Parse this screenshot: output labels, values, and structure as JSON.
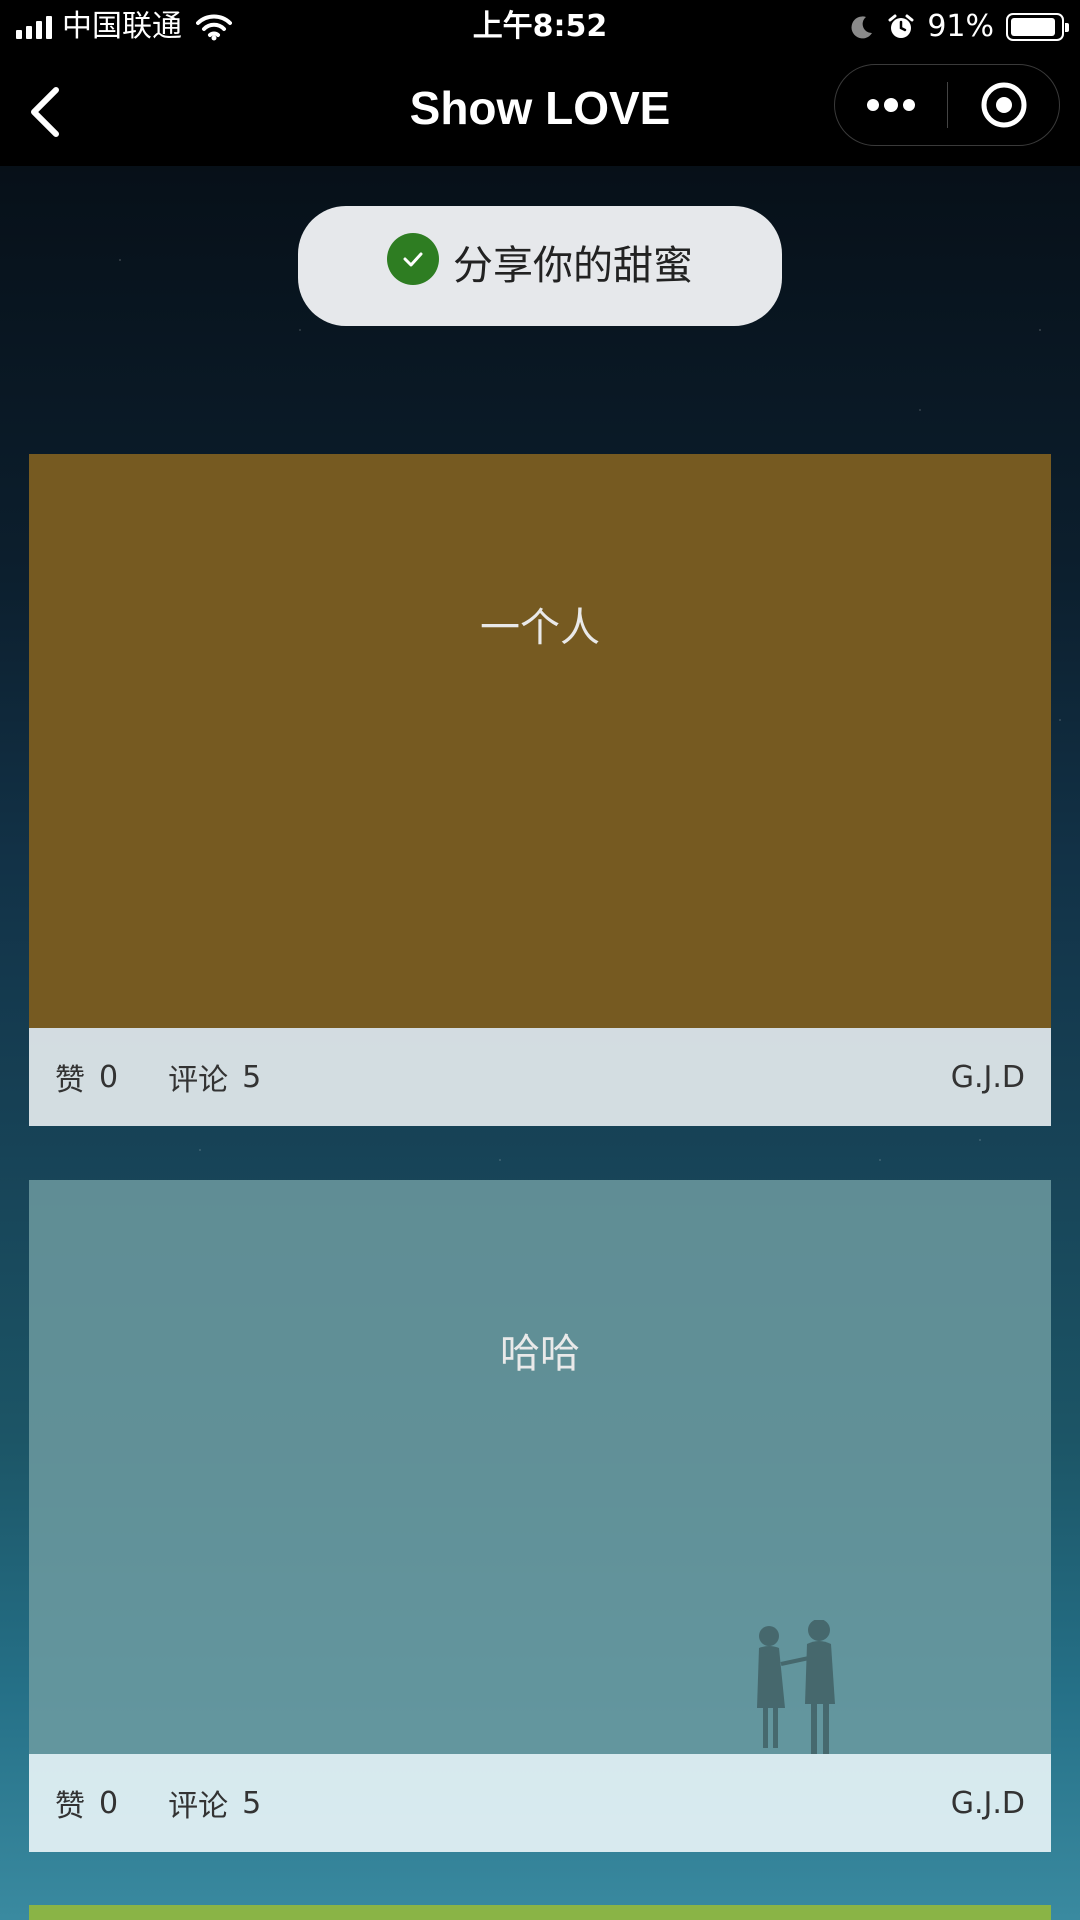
{
  "status_bar": {
    "carrier": "中国联通",
    "time": "上午8:52",
    "battery_pct": "91%",
    "battery_level": 0.91
  },
  "nav": {
    "title": "Show LOVE"
  },
  "toast": {
    "text": "分享你的甜蜜",
    "icon": "check-circle-icon",
    "color": "#2e7d22"
  },
  "cards": [
    {
      "title": "一个人",
      "like_label": "赞",
      "like_count": "0",
      "comment_label": "评论",
      "comment_count": "5",
      "author": "G.J.D",
      "color": "#765a21"
    },
    {
      "title": "哈哈",
      "like_label": "赞",
      "like_count": "0",
      "comment_label": "评论",
      "comment_count": "5",
      "author": "G.J.D",
      "color": "#709ea2"
    }
  ],
  "next_card_color": "#8ab446"
}
